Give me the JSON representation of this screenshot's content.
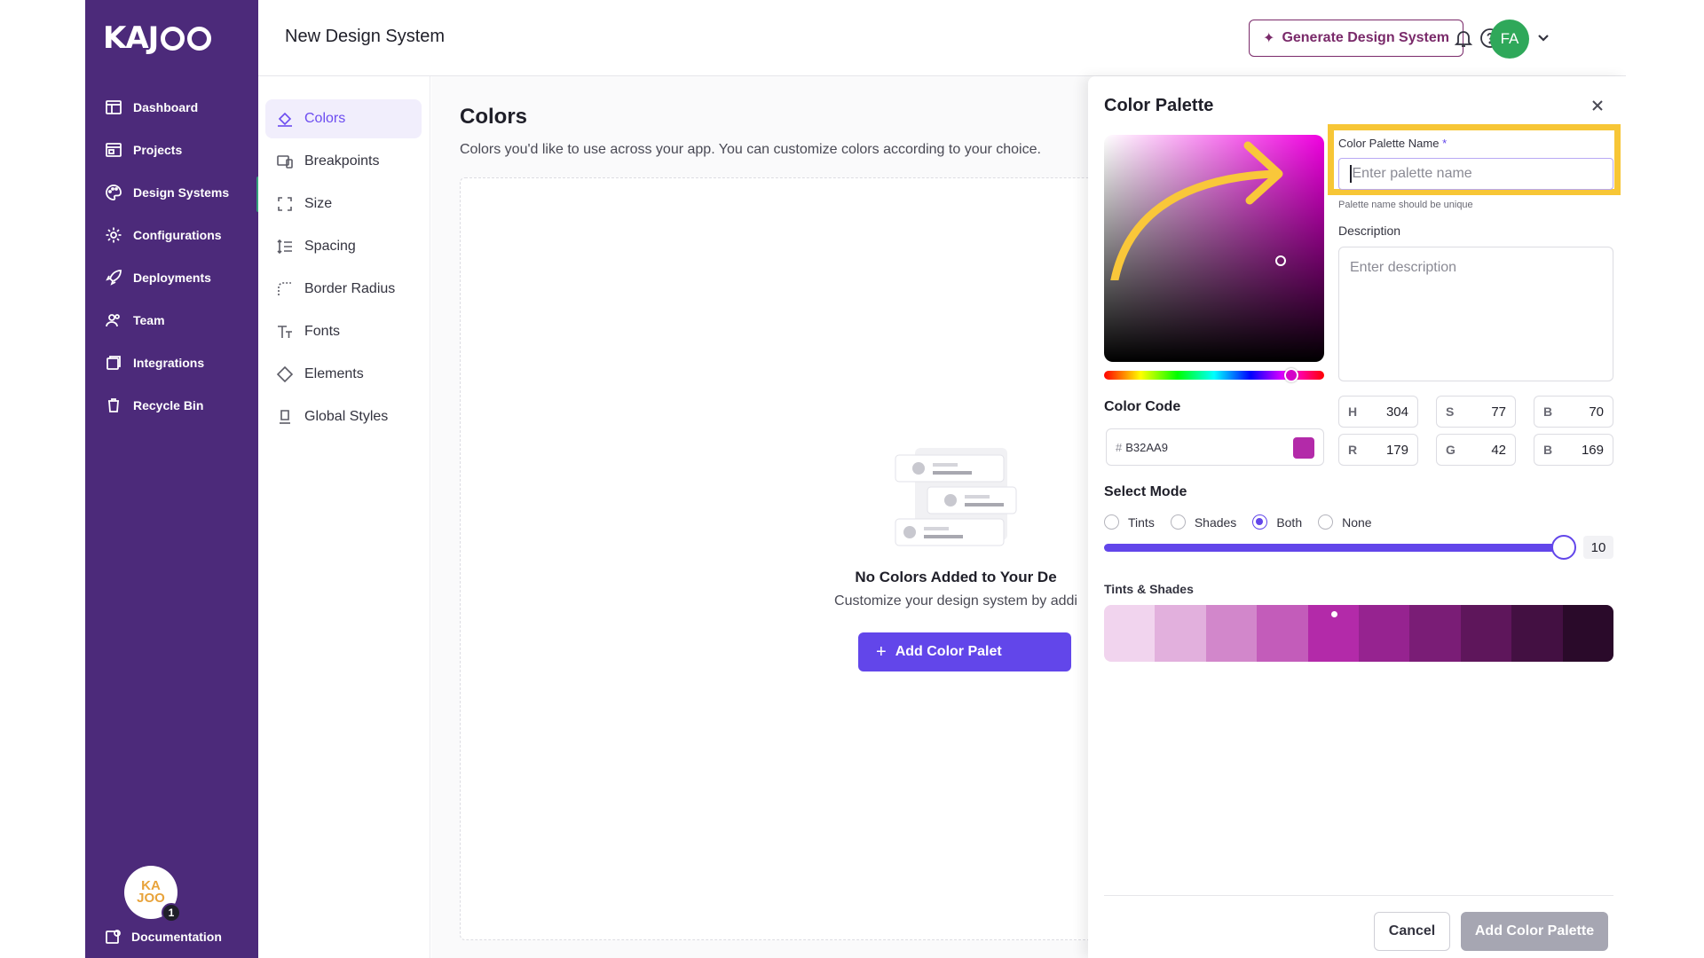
{
  "brand": {
    "logo_text": "KAJOO"
  },
  "sidebar": {
    "items": [
      {
        "label": "Dashboard",
        "icon": "dashboard-icon"
      },
      {
        "label": "Projects",
        "icon": "projects-icon"
      },
      {
        "label": "Design Systems",
        "icon": "palette-icon",
        "active": true
      },
      {
        "label": "Configurations",
        "icon": "gear-icon"
      },
      {
        "label": "Deployments",
        "icon": "rocket-icon"
      },
      {
        "label": "Team",
        "icon": "team-icon"
      },
      {
        "label": "Integrations",
        "icon": "integrations-icon"
      },
      {
        "label": "Recycle Bin",
        "icon": "trash-icon"
      }
    ],
    "support_badge": "1",
    "documentation_label": "Documentation"
  },
  "header": {
    "title": "New Design System",
    "generate_label": "Generate Design System",
    "avatar_initials": "FA"
  },
  "submenu": {
    "items": [
      {
        "label": "Colors",
        "icon": "color-fill-icon",
        "active": true
      },
      {
        "label": "Breakpoints",
        "icon": "devices-icon"
      },
      {
        "label": "Size",
        "icon": "expand-icon"
      },
      {
        "label": "Spacing",
        "icon": "spacing-icon"
      },
      {
        "label": "Border Radius",
        "icon": "border-radius-icon"
      },
      {
        "label": "Fonts",
        "icon": "font-icon"
      },
      {
        "label": "Elements",
        "icon": "diamond-icon"
      },
      {
        "label": "Global Styles",
        "icon": "global-styles-icon"
      }
    ]
  },
  "main": {
    "title": "Colors",
    "description": "Colors you'd like to use across your app. You can customize colors according to your choice.",
    "empty_title": "No Colors Added to Your De",
    "empty_subtitle": "Customize your design system by addi",
    "add_button": "Add Color Palet"
  },
  "drawer": {
    "title": "Color Palette",
    "name_label": "Color Palette Name",
    "name_required": "*",
    "name_placeholder": "Enter palette name",
    "name_hint": "Palette name should be unique",
    "description_label": "Description",
    "description_placeholder": "Enter description",
    "color_code_label": "Color Code",
    "hex_prefix": "#",
    "hex_value": "B32AA9",
    "selected_color": "#b32aa9",
    "hsb": {
      "h_label": "H",
      "h": "304",
      "s_label": "S",
      "s": "77",
      "b_label": "B",
      "b": "70"
    },
    "rgb": {
      "r_label": "R",
      "r": "179",
      "g_label": "G",
      "g": "42",
      "b_label": "B",
      "b": "169"
    },
    "select_mode_label": "Select Mode",
    "modes": [
      "Tints",
      "Shades",
      "Both",
      "None"
    ],
    "selected_mode": "Both",
    "count_value": "10",
    "tints_shades_label": "Tints & Shades",
    "shade_colors": [
      "#f1d4ee",
      "#e2b0dd",
      "#d287cb",
      "#c35cba",
      "#b32aa9",
      "#962390",
      "#7a1d76",
      "#5e165b",
      "#431042",
      "#2a0a2a"
    ],
    "cancel_label": "Cancel",
    "submit_label": "Add Color Palette"
  }
}
